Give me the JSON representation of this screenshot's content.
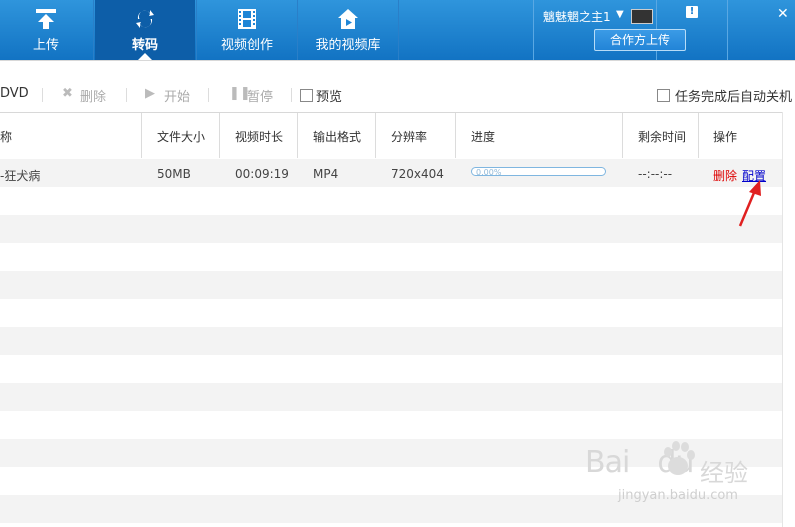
{
  "nav": {
    "tabs": [
      {
        "label": "上传",
        "icon": "upload-icon"
      },
      {
        "label": "转码",
        "icon": "transcode-icon",
        "active": true
      },
      {
        "label": "视频创作",
        "icon": "film-icon"
      },
      {
        "label": "我的视频库",
        "icon": "home-icon"
      }
    ],
    "username": "魑魅魍之主1",
    "partner_upload": "合作方上传",
    "notice_icon": "!",
    "close_icon": "✕"
  },
  "toolbar": {
    "dvd": "DVD",
    "delete": "删除",
    "start": "开始",
    "pause": "暂停",
    "preview": "预览",
    "auto_shutdown": "任务完成后自动关机"
  },
  "table": {
    "headers": [
      "称",
      "文件大小",
      "视频时长",
      "输出格式",
      "分辨率",
      "进度",
      "剩余时间",
      "操作"
    ],
    "rows": [
      {
        "name": "-狂犬病",
        "size": "50MB",
        "duration": "00:09:19",
        "format": "MP4",
        "resolution": "720x404",
        "progress": "0.00%",
        "progress_value": 0,
        "remaining": "--:--:--",
        "delete": "删除",
        "config": "配置"
      }
    ]
  },
  "colors": {
    "header_blue": "#1f86d6",
    "delete_red": "#dd0000",
    "config_blue": "#0000cc",
    "arrow_red": "#e02020"
  },
  "watermark": {
    "brand": "Bai",
    "brand2": "du",
    "cn": "经验",
    "url": "jingyan.baidu.com"
  }
}
